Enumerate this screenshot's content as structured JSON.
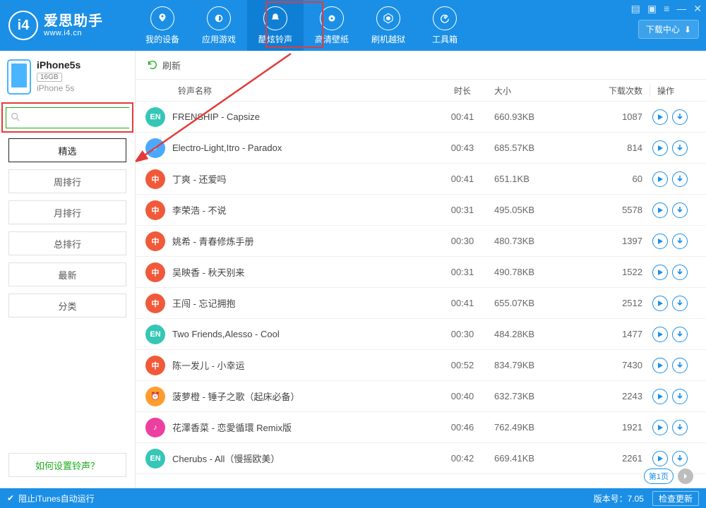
{
  "app": {
    "name_cn": "爱思助手",
    "url": "www.i4.cn"
  },
  "nav": [
    {
      "key": "device",
      "label": "我的设备"
    },
    {
      "key": "apps",
      "label": "应用游戏"
    },
    {
      "key": "ringtone",
      "label": "酷炫铃声",
      "active": true
    },
    {
      "key": "wallpaper",
      "label": "高清壁纸"
    },
    {
      "key": "flash",
      "label": "刷机越狱"
    },
    {
      "key": "toolbox",
      "label": "工具箱"
    }
  ],
  "download_center": "下载中心",
  "device": {
    "name": "iPhone5s",
    "capacity": "16GB",
    "model": "iPhone 5s"
  },
  "search": {
    "placeholder": "",
    "button": "搜索"
  },
  "sidebar": {
    "items": [
      {
        "label": "精选",
        "active": true
      },
      {
        "label": "周排行"
      },
      {
        "label": "月排行"
      },
      {
        "label": "总排行"
      },
      {
        "label": "最新"
      },
      {
        "label": "分类"
      }
    ],
    "help": "如何设置铃声？"
  },
  "toolbar": {
    "refresh": "刷新"
  },
  "columns": {
    "name": "铃声名称",
    "time": "时长",
    "size": "大小",
    "count": "下载次数",
    "ops": "操作"
  },
  "ringtones": [
    {
      "badge": "EN",
      "badge_color": "#35c6b6",
      "title": "FRENSHIP - Capsize",
      "time": "00:41",
      "size": "660.93KB",
      "count": "1087"
    },
    {
      "badge": "♪",
      "badge_color": "#4aa8ff",
      "title": "Electro-Light,Itro - Paradox",
      "time": "00:43",
      "size": "685.57KB",
      "count": "814"
    },
    {
      "badge": "中",
      "badge_color": "#f05a3a",
      "title": "丁爽 - 还爱吗",
      "time": "00:41",
      "size": "651.1KB",
      "count": "60"
    },
    {
      "badge": "中",
      "badge_color": "#f05a3a",
      "title": "李荣浩 - 不说",
      "time": "00:31",
      "size": "495.05KB",
      "count": "5578"
    },
    {
      "badge": "中",
      "badge_color": "#f05a3a",
      "title": "姚希 - 青春修炼手册",
      "time": "00:30",
      "size": "480.73KB",
      "count": "1397"
    },
    {
      "badge": "中",
      "badge_color": "#f05a3a",
      "title": "吴映香 - 秋天别来",
      "time": "00:31",
      "size": "490.78KB",
      "count": "1522"
    },
    {
      "badge": "中",
      "badge_color": "#f05a3a",
      "title": "王闯 - 忘记拥抱",
      "time": "00:41",
      "size": "655.07KB",
      "count": "2512"
    },
    {
      "badge": "EN",
      "badge_color": "#35c6b6",
      "title": "Two Friends,Alesso - Cool",
      "time": "00:30",
      "size": "484.28KB",
      "count": "1477"
    },
    {
      "badge": "中",
      "badge_color": "#f05a3a",
      "title": "陈一发儿 - 小幸运",
      "time": "00:52",
      "size": "834.79KB",
      "count": "7430"
    },
    {
      "badge": "⏰",
      "badge_color": "#ff9d2e",
      "title": "菠萝橙 - 锤子之歌（起床必备）",
      "time": "00:40",
      "size": "632.73KB",
      "count": "2243"
    },
    {
      "badge": "♪",
      "badge_color": "#ec3fa0",
      "title": "花澤香菜 - 恋愛循環 Remix版",
      "time": "00:46",
      "size": "762.49KB",
      "count": "1921"
    },
    {
      "badge": "EN",
      "badge_color": "#35c6b6",
      "title": "Cherubs - All（慢摇欧美）",
      "time": "00:42",
      "size": "669.41KB",
      "count": "2261"
    }
  ],
  "pager": {
    "page_label": "第1页"
  },
  "footer": {
    "itunes_block": "阻止iTunes自动运行",
    "version_label": "版本号：",
    "version": "7.05",
    "check_update": "检查更新"
  }
}
